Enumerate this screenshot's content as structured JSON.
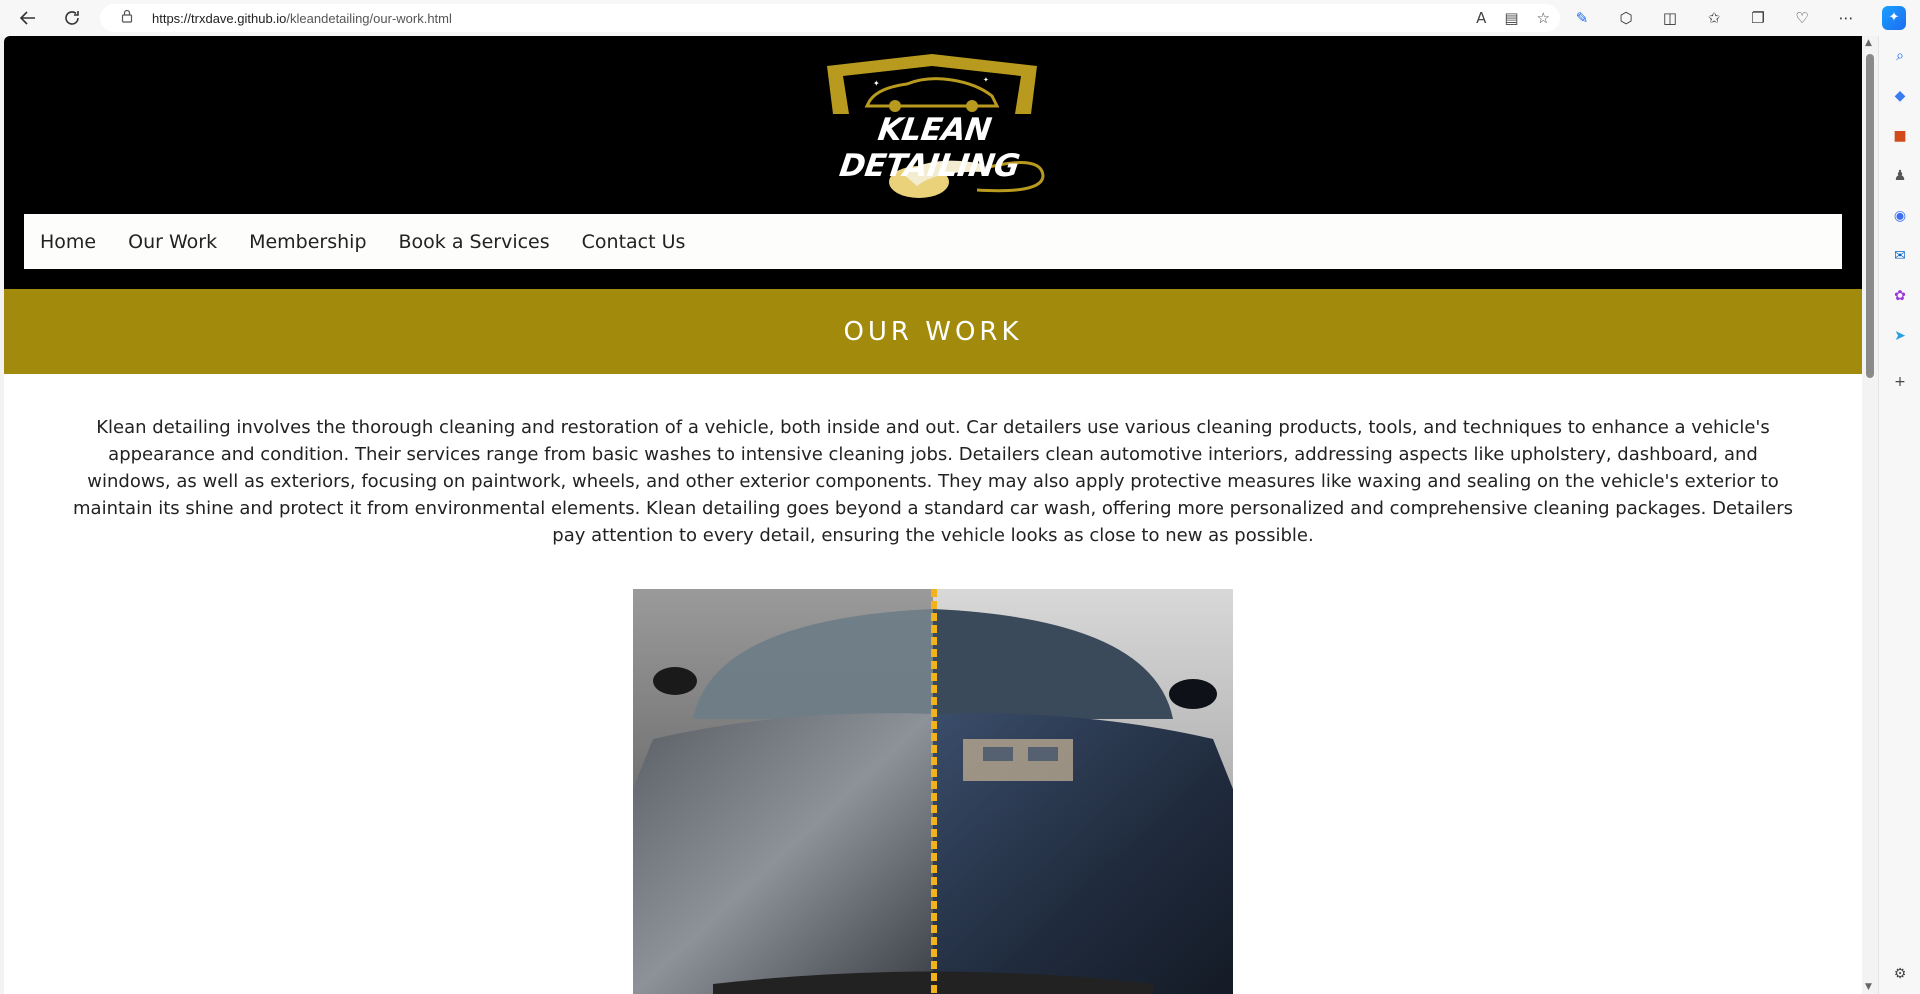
{
  "browser": {
    "url_host": "https://trxdave.github.io",
    "url_path": "/kleandetailing/our-work.html"
  },
  "site": {
    "logo_text": "KLEAN DETAILING",
    "nav": [
      "Home",
      "Our Work",
      "Membership",
      "Book a Services",
      "Contact Us"
    ],
    "banner_title": "OUR WORK",
    "intro": "Klean detailing involves the thorough cleaning and restoration of a vehicle, both inside and out. Car detailers use various cleaning products, tools, and techniques to enhance a vehicle's appearance and condition. Their services range from basic washes to intensive cleaning jobs. Detailers clean automotive interiors, addressing aspects like upholstery, dashboard, and windows, as well as exteriors, focusing on paintwork, wheels, and other exterior components. They may also apply protective measures like waxing and sealing on the vehicle's exterior to maintain its shine and protect it from environmental elements. Klean detailing goes beyond a standard car wash, offering more personalized and comprehensive cleaning packages. Detailers pay attention to every detail, ensuring the vehicle looks as close to new as possible."
  },
  "colors": {
    "header_bg": "#000000",
    "banner_bg": "#a18a0c",
    "logo_gold": "#b89a1f",
    "divider": "#f2b21a"
  }
}
